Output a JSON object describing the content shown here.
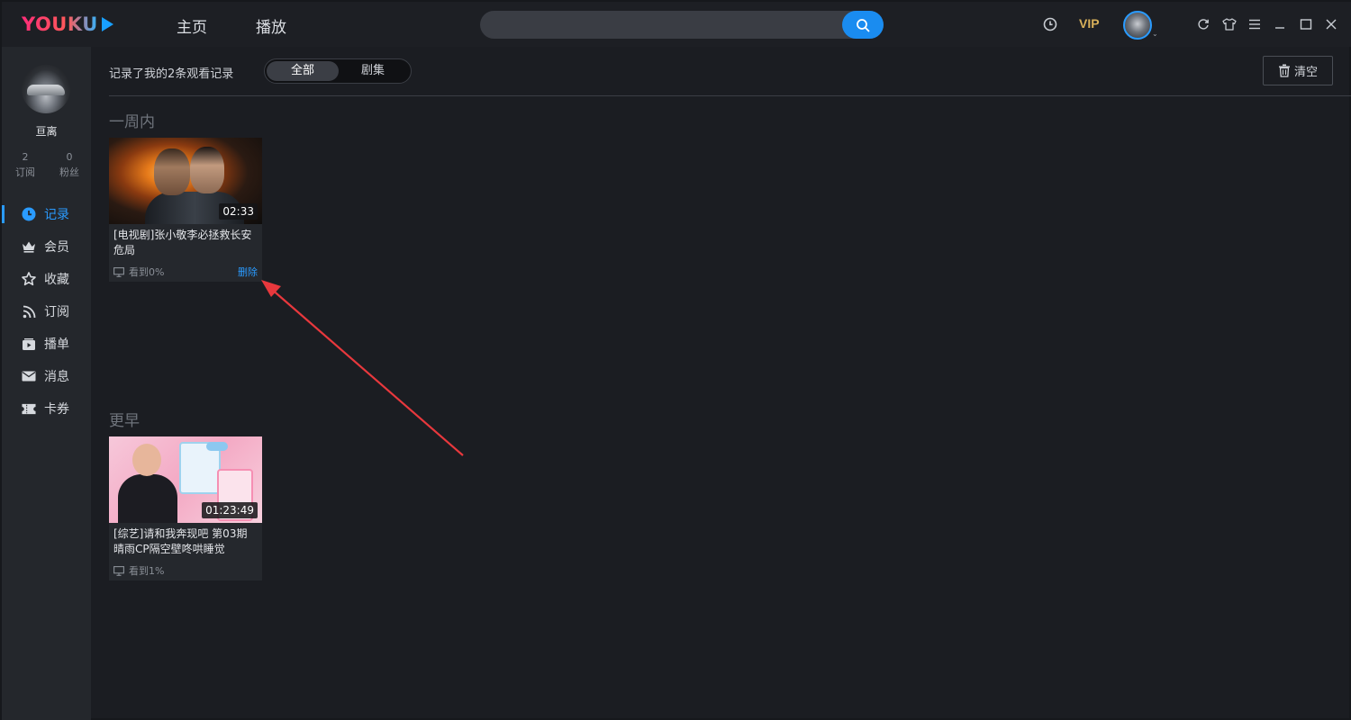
{
  "topbar": {
    "logo_text": "YOUKU",
    "nav_home": "主页",
    "nav_play": "播放",
    "search": {
      "value": "",
      "placeholder": ""
    },
    "vip_label": "VIP"
  },
  "sidebar": {
    "username": "亘离",
    "stats": [
      {
        "value": "2",
        "label": "订阅"
      },
      {
        "value": "0",
        "label": "粉丝"
      }
    ],
    "items": [
      {
        "label": "记录",
        "icon": "clock-icon",
        "active": true
      },
      {
        "label": "会员",
        "icon": "crown-icon",
        "active": false
      },
      {
        "label": "收藏",
        "icon": "star-icon",
        "active": false
      },
      {
        "label": "订阅",
        "icon": "rss-icon",
        "active": false
      },
      {
        "label": "播单",
        "icon": "playlist-icon",
        "active": false
      },
      {
        "label": "消息",
        "icon": "mail-icon",
        "active": false
      },
      {
        "label": "卡券",
        "icon": "ticket-icon",
        "active": false
      }
    ]
  },
  "history": {
    "summary": "记录了我的2条观看记录",
    "filter_all": "全部",
    "filter_series": "剧集",
    "clear_label": "清空",
    "sections": [
      {
        "title": "一周内",
        "videos": [
          {
            "title": "[电视剧]张小敬李必拯救长安危局",
            "duration": "02:33",
            "progress": "看到0%",
            "delete_label": "删除"
          }
        ]
      },
      {
        "title": "更早",
        "videos": [
          {
            "title": "[综艺]请和我奔现吧 第03期 晴雨CP隔空壁咚哄睡觉",
            "duration": "01:23:49",
            "progress": "看到1%"
          }
        ]
      }
    ]
  },
  "colors": {
    "accent": "#2a9bff",
    "background": "#1b1d22",
    "sidebar": "#24272c",
    "annotation_arrow": "#e8383d"
  }
}
